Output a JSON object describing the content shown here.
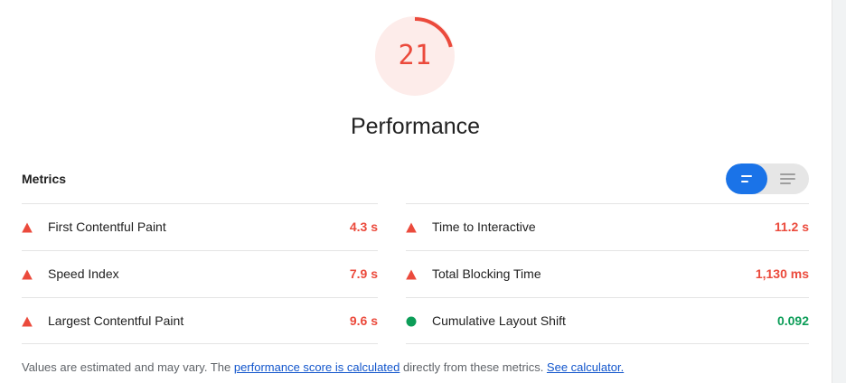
{
  "score": {
    "value": "21",
    "fraction": 0.21,
    "color": "#eb4a3c",
    "background": "#fdecea"
  },
  "category": {
    "title": "Performance"
  },
  "metrics": {
    "header": "Metrics",
    "toggle": {
      "selected": "summary",
      "active_color": "#1a73e8",
      "icons": [
        "summary-lines-icon",
        "detail-lines-icon"
      ]
    },
    "items": [
      {
        "label": "First Contentful Paint",
        "value": "4.3 s",
        "status": "fail",
        "icon": "warning-triangle-icon"
      },
      {
        "label": "Time to Interactive",
        "value": "11.2 s",
        "status": "fail",
        "icon": "warning-triangle-icon"
      },
      {
        "label": "Speed Index",
        "value": "7.9 s",
        "status": "fail",
        "icon": "warning-triangle-icon"
      },
      {
        "label": "Total Blocking Time",
        "value": "1,130 ms",
        "status": "fail",
        "icon": "warning-triangle-icon"
      },
      {
        "label": "Largest Contentful Paint",
        "value": "9.6 s",
        "status": "fail",
        "icon": "warning-triangle-icon"
      },
      {
        "label": "Cumulative Layout Shift",
        "value": "0.092",
        "status": "pass",
        "icon": "pass-circle-icon"
      }
    ]
  },
  "status_colors": {
    "fail": "#eb4a3c",
    "pass": "#0c9d58"
  },
  "footer": {
    "text_before": "Values are estimated and may vary. The ",
    "link1": "performance score is calculated",
    "text_middle": " directly from these metrics. ",
    "link2": "See calculator."
  }
}
